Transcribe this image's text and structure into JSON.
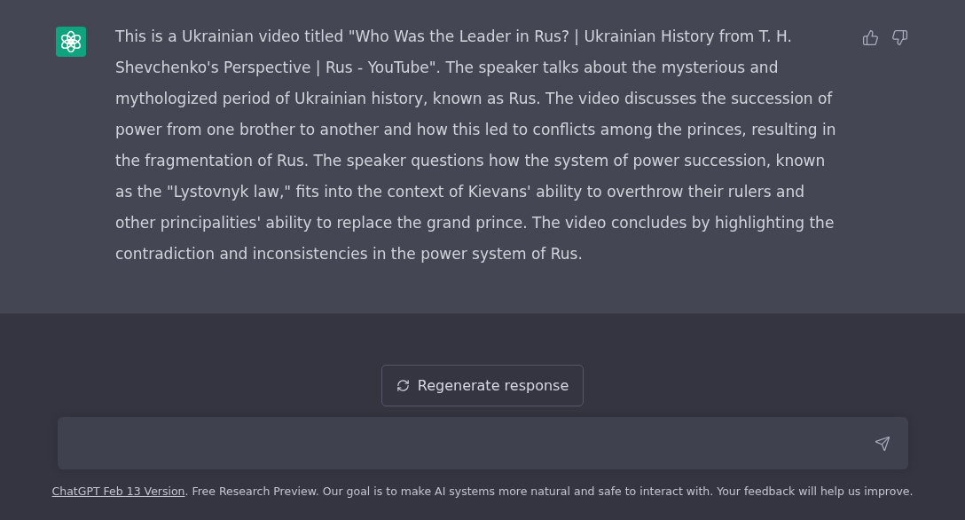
{
  "message": {
    "text": "This is a Ukrainian video titled \"Who Was the Leader in Rus? | Ukrainian History from T. H. Shevchenko's Perspective | Rus - YouTube\". The speaker talks about the mysterious and mythologized period of Ukrainian history, known as Rus. The video discusses the succession of power from one brother to another and how this led to conflicts among the princes, resulting in the fragmentation of Rus. The speaker questions how the system of power succession, known as the \"Lystovnyk law,\" fits into the context of Kievans' ability to overthrow their rulers and other principalities' ability to replace the grand prince. The video concludes by highlighting the contradiction and inconsistencies in the power system of Rus."
  },
  "regenerate_button": {
    "label": "Regenerate response"
  },
  "footer": {
    "link": "ChatGPT Feb 13 Version",
    "text": ". Free Research Preview. Our goal is to make AI systems more natural and safe to interact with. Your feedback will help us improve."
  }
}
